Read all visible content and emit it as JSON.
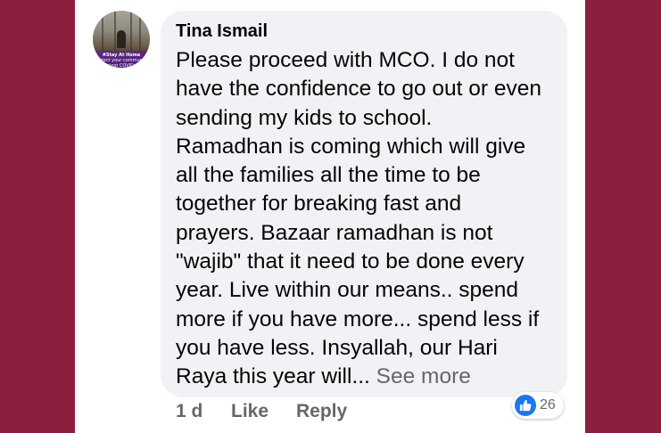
{
  "comment": {
    "author": "Tina Ismail",
    "avatar_badge": "#Stay At Home",
    "avatar_badge_sub": "Protect your community against COVID-19",
    "lines": [
      "Please proceed with MCO. I do not",
      "have the confidence to go out or even",
      "sending my kids to school.",
      "Ramadhan is coming which will give",
      "all the families all the time to be",
      "together for breaking fast and",
      "prayers. Bazaar ramadhan is not",
      "\"wajib\" that it need to be done every",
      "year. Live within our means.. spend",
      "more if you have more... spend less if",
      "you have less. Insyallah, our Hari"
    ],
    "last_line": "Raya this year will... ",
    "see_more": "See more"
  },
  "actions": {
    "time": "1 d",
    "like": "Like",
    "reply": "Reply"
  },
  "reactions": {
    "icon": "like-thumb-icon",
    "count": "26"
  },
  "colors": {
    "background": "#8b1f3d",
    "bubble": "#f0f2f5",
    "like_blue": "#1877f2",
    "muted_text": "#65676b"
  }
}
